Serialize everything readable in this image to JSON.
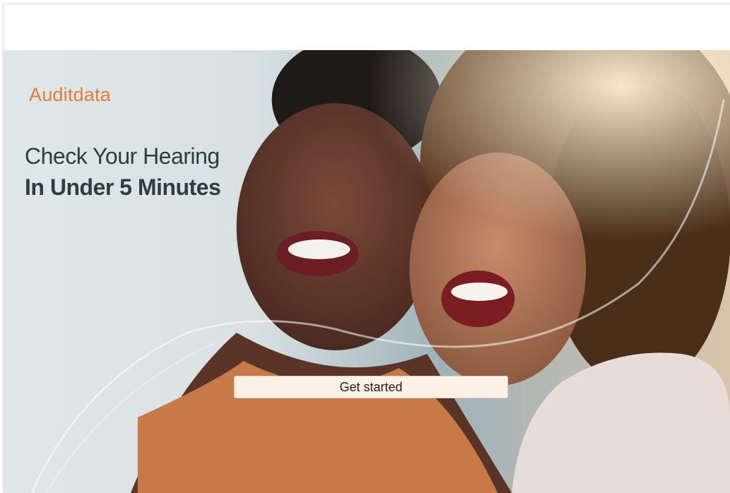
{
  "brand": {
    "name": "Auditdata",
    "color": "#e57b3c"
  },
  "hero": {
    "headline_line1": "Check Your Hearing",
    "headline_line2": "In Under 5 Minutes",
    "cta_label": "Get started"
  },
  "colors": {
    "headline": "#2c3e44",
    "cta_background": "#fdf0e6",
    "page_background": "#ffffff"
  }
}
